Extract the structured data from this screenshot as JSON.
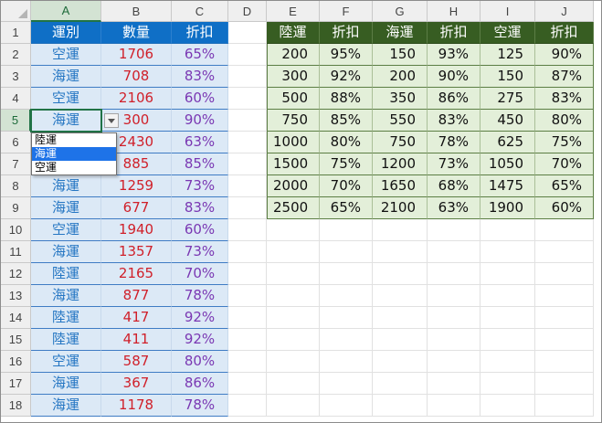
{
  "columns": [
    "A",
    "B",
    "C",
    "D",
    "E",
    "F",
    "G",
    "H",
    "I",
    "J"
  ],
  "rows": [
    "1",
    "2",
    "3",
    "4",
    "5",
    "6",
    "7",
    "8",
    "9",
    "10",
    "11",
    "12",
    "13",
    "14",
    "15",
    "16",
    "17",
    "18"
  ],
  "selection": {
    "column": "A",
    "row": "5"
  },
  "table1": {
    "headers": [
      "運別",
      "數量",
      "折扣"
    ],
    "rows": [
      [
        "空運",
        "1706",
        "65%"
      ],
      [
        "海運",
        "708",
        "83%"
      ],
      [
        "空運",
        "2106",
        "60%"
      ],
      [
        "海運",
        "300",
        "90%"
      ],
      [
        "",
        "2430",
        "63%"
      ],
      [
        "",
        "885",
        "85%"
      ],
      [
        "海運",
        "1259",
        "73%"
      ],
      [
        "海運",
        "677",
        "83%"
      ],
      [
        "空運",
        "1940",
        "60%"
      ],
      [
        "海運",
        "1357",
        "73%"
      ],
      [
        "陸運",
        "2165",
        "70%"
      ],
      [
        "海運",
        "877",
        "78%"
      ],
      [
        "陸運",
        "417",
        "92%"
      ],
      [
        "陸運",
        "411",
        "92%"
      ],
      [
        "空運",
        "587",
        "80%"
      ],
      [
        "海運",
        "367",
        "86%"
      ],
      [
        "海運",
        "1178",
        "78%"
      ]
    ]
  },
  "table2": {
    "headers": [
      "陸運",
      "折扣",
      "海運",
      "折扣",
      "空運",
      "折扣"
    ],
    "rows": [
      [
        "200",
        "95%",
        "150",
        "93%",
        "125",
        "90%"
      ],
      [
        "300",
        "92%",
        "200",
        "90%",
        "150",
        "87%"
      ],
      [
        "500",
        "88%",
        "350",
        "86%",
        "275",
        "83%"
      ],
      [
        "750",
        "85%",
        "550",
        "83%",
        "450",
        "80%"
      ],
      [
        "1000",
        "80%",
        "750",
        "78%",
        "625",
        "75%"
      ],
      [
        "1500",
        "75%",
        "1200",
        "73%",
        "1050",
        "70%"
      ],
      [
        "2000",
        "70%",
        "1650",
        "68%",
        "1475",
        "65%"
      ],
      [
        "2500",
        "65%",
        "2100",
        "63%",
        "1900",
        "60%"
      ]
    ]
  },
  "dropdown": {
    "options": [
      "陸運",
      "海運",
      "空運"
    ],
    "highlighted_index": 1
  }
}
